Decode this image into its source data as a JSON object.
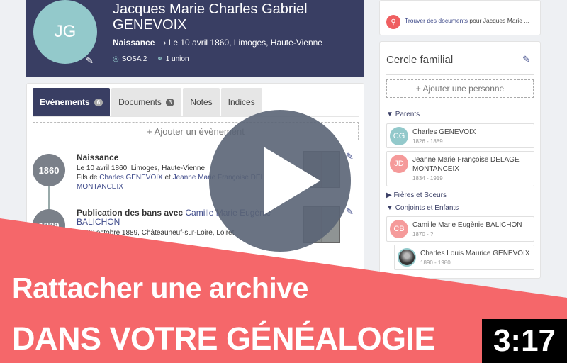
{
  "person": {
    "initials": "JG",
    "name": "Jacques Marie Charles Gabriel GENEVOIX",
    "birth_label": "Naissance",
    "birth_value": "› Le 10 avril 1860, Limoges, Haute-Vienne",
    "sosa": "SOSA 2",
    "unions": "1 union"
  },
  "tabs": [
    {
      "label": "Evènements",
      "count": "6"
    },
    {
      "label": "Documents",
      "count": "3"
    },
    {
      "label": "Notes"
    },
    {
      "label": "Indices"
    }
  ],
  "add_event": "+ Ajouter un évènement",
  "events": [
    {
      "year": "1860",
      "title": "Naissance",
      "detail": "Le 10 avril 1860, Limoges, Haute-Vienne",
      "rel_prefix": "Fils de ",
      "parent1": "Charles GENEVOIX",
      "rel_and": " et ",
      "parent2": "Jeanne Marie Françoise DELAGE MONTANCEIX"
    },
    {
      "year": "1889",
      "title": "Publication des bans avec ",
      "spouse": "Camille Marie Eugènie BALICHON",
      "detail": "Le 06 octobre 1889, Châteauneuf-sur-Loire, Loiret"
    }
  ],
  "find": {
    "link": "Trouver des documents",
    "rest": " pour Jacques Marie ..."
  },
  "family": {
    "title": "Cercle familial",
    "add": "+ Ajouter une personne",
    "parents_label": "Parents",
    "siblings_label": "Frères et Soeurs",
    "spouses_label": "Conjoints et Enfants",
    "parents": [
      {
        "initials": "CG",
        "name": "Charles GENEVOIX",
        "dates": "1826 - 1889",
        "color": "#93c9cb"
      },
      {
        "initials": "JD",
        "name": "Jeanne Marie Françoise DELAGE MONTANCEIX",
        "dates": "1834 - 1919",
        "color": "#f59a9a"
      }
    ],
    "spouse": {
      "initials": "CB",
      "name": "Camille Marie Eugènie BALICHON",
      "dates": "1870 - ?",
      "color": "#f59a9a"
    },
    "child": {
      "name": "Charles Louis Maurice GENEVOIX",
      "dates": "1890 - 1980"
    }
  },
  "overlay": {
    "line1": "Rattacher une archive",
    "line2": "DANS VOTRE GÉNÉALOGIE",
    "duration": "3:17",
    "banner_color": "#f5676a"
  }
}
